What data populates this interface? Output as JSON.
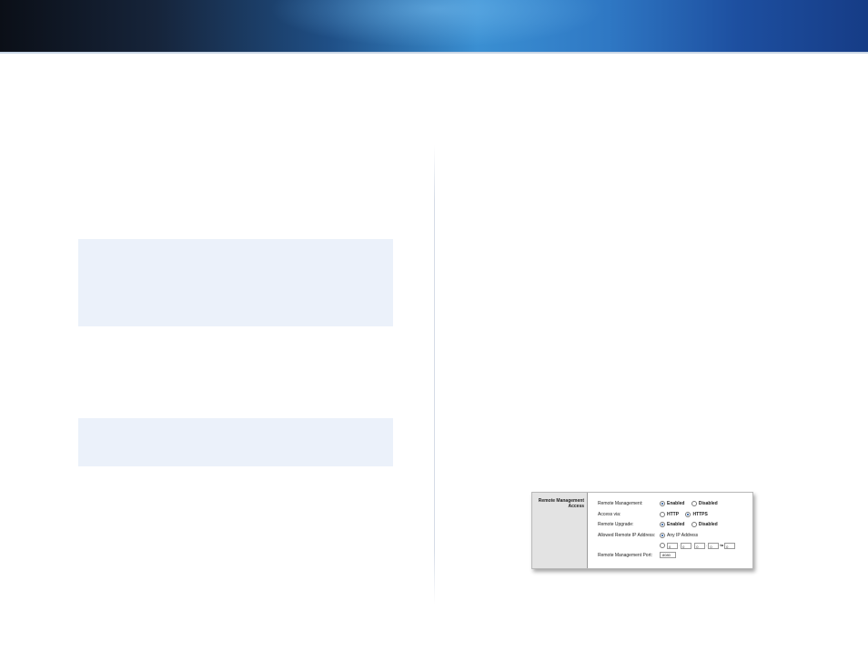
{
  "panel": {
    "section_title": "Remote Management Access",
    "remote_management": {
      "label": "Remote  Management:",
      "options": [
        "Enabled",
        "Disabled"
      ],
      "selected": "Enabled"
    },
    "access_via": {
      "label": "Access via:",
      "options": [
        "HTTP",
        "HTTPS"
      ],
      "selected": "HTTPS"
    },
    "remote_upgrade": {
      "label": "Remote Upgrade:",
      "options": [
        "Enabled",
        "Disabled"
      ],
      "selected": "Enabled"
    },
    "allowed_ip": {
      "label": "Allowed Remote IP Address:",
      "any_label": "Any IP Address",
      "range_values": [
        "0",
        "0",
        "0",
        "0",
        "0"
      ],
      "to_label": "to"
    },
    "port": {
      "label": "Remote Management Port:",
      "value": "8080"
    }
  }
}
